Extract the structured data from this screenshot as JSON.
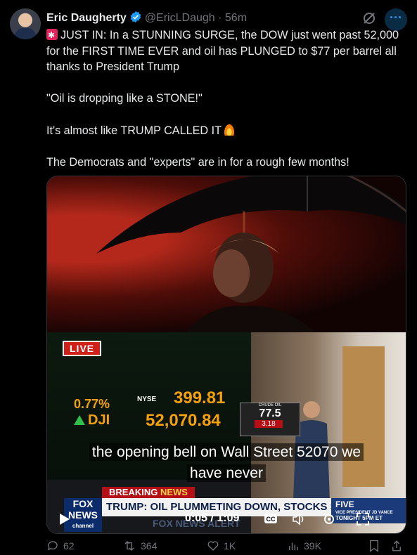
{
  "tweet": {
    "author_name": "Eric Daugherty",
    "handle": "@EricLDaugh",
    "separator": "·",
    "time": "56m",
    "lines": [
      "JUST IN: In a STUNNING SURGE, the DOW just went past 52,000 for the FIRST TIME EVER and oil has PLUNGED to $77 per barrel all thanks to President Trump",
      "\"Oil is dropping like a STONE!\"",
      "It's almost like TRUMP CALLED IT",
      "The Democrats and \"experts\" are in for a rough few months!"
    ],
    "icons": {
      "verified": "verified-badge-icon",
      "grok": "grok-icon",
      "more": "more-icon",
      "siren": "siren-emoji-icon",
      "fire": "fire-emoji-icon"
    },
    "accent": "#1d9bf0"
  },
  "video": {
    "live_label": "LIVE",
    "nyse_label": "NYSE",
    "pct": "0.77%",
    "dji_label": "DJI",
    "nyse_value": "399.81",
    "dji_value": "52,070.84",
    "oil_label": "CRUDE OIL",
    "oil_value": "77.5",
    "oil_change": "3.18",
    "subtitle_line1": "the opening bell on Wall Street 52070 we",
    "subtitle_line2": "have never",
    "breaking_left": "BREAKING ",
    "breaking_right": "NEWS",
    "banner": "TRUMP: OIL PLUMMETING DOWN, STOCKS SHOOTING UP",
    "fox_logo_top": "FOX",
    "fox_logo_bottom": "NEWS",
    "fox_logo_sub": "channel",
    "ticker_text": "FOX NEWS ALERT",
    "five_label": "FIVE",
    "five_sub": "VICE PRESIDENT JD VANCE",
    "five_time": "TONIGHT 5PM ET",
    "time_display": "0:05 / 1:09",
    "icons": {
      "play": "play-icon",
      "cc": "cc-icon",
      "volume": "volume-icon",
      "settings": "settings-icon",
      "fullscreen": "fullscreen-icon"
    }
  },
  "actions": {
    "replies": "62",
    "reposts": "364",
    "likes": "1K",
    "views": "39K"
  }
}
